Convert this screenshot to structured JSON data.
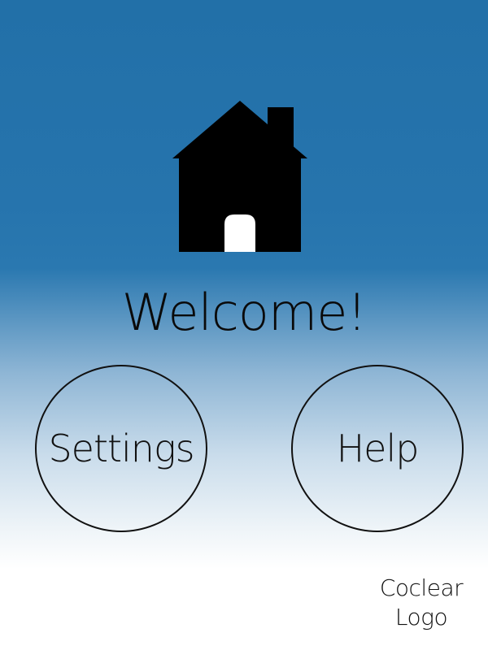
{
  "header": {
    "icon": "home-icon",
    "title": "Welcome!"
  },
  "buttons": {
    "settings_label": "Settings",
    "help_label": "Help"
  },
  "footer": {
    "logo_line1": "Coclear",
    "logo_line2": "Logo"
  },
  "colors": {
    "background_top": "#2270a8",
    "background_bottom": "#ffffff",
    "icon": "#000000",
    "text": "#111111"
  }
}
